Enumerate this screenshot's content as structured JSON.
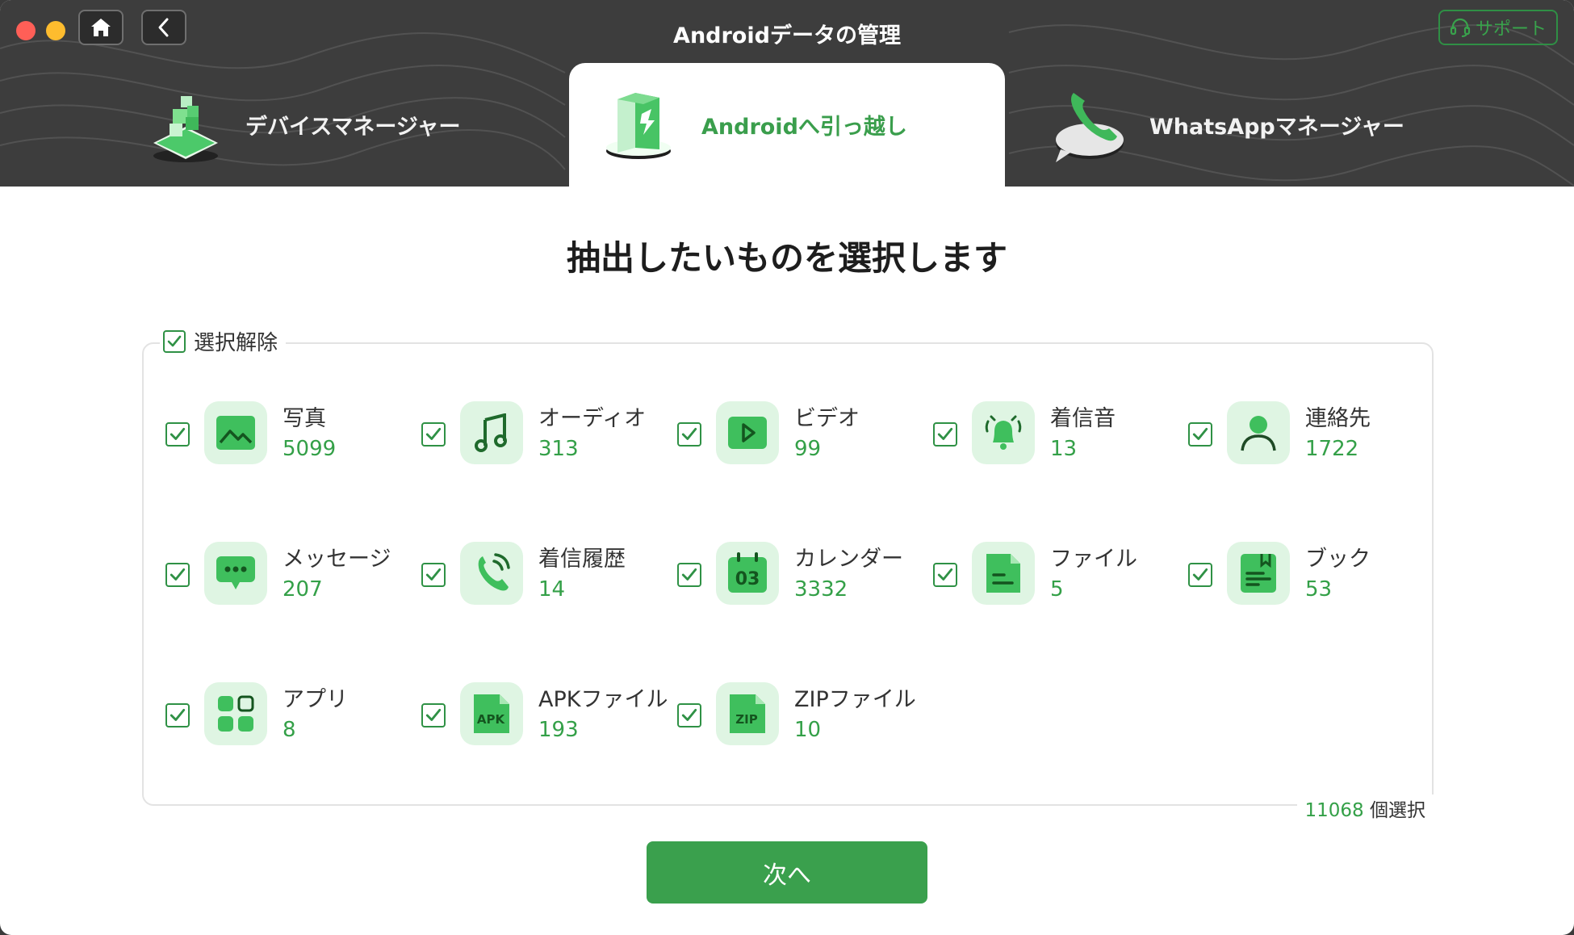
{
  "window": {
    "title": "Androidデータの管理",
    "support_label": "サポート"
  },
  "tabs": [
    {
      "label": "デバイスマネージャー",
      "icon": "device-manager-icon",
      "active": false
    },
    {
      "label": "Androidへ引っ越し",
      "icon": "android-transfer-icon",
      "active": true
    },
    {
      "label": "WhatsAppマネージャー",
      "icon": "whatsapp-phone-icon",
      "active": false
    }
  ],
  "main": {
    "heading": "抽出したいものを選択します",
    "deselect_label": "選択解除",
    "items": [
      {
        "name": "写真",
        "count": "5099",
        "icon": "photo-icon",
        "checked": true
      },
      {
        "name": "オーディオ",
        "count": "313",
        "icon": "music-note-icon",
        "checked": true
      },
      {
        "name": "ビデオ",
        "count": "99",
        "icon": "video-play-icon",
        "checked": true
      },
      {
        "name": "着信音",
        "count": "13",
        "icon": "ringtone-bell-icon",
        "checked": true
      },
      {
        "name": "連絡先",
        "count": "1722",
        "icon": "contact-person-icon",
        "checked": true
      },
      {
        "name": "メッセージ",
        "count": "207",
        "icon": "message-bubble-icon",
        "checked": true
      },
      {
        "name": "着信履歴",
        "count": "14",
        "icon": "call-history-icon",
        "checked": true
      },
      {
        "name": "カレンダー",
        "count": "3332",
        "icon": "calendar-icon",
        "checked": true
      },
      {
        "name": "ファイル",
        "count": "5",
        "icon": "file-icon",
        "checked": true
      },
      {
        "name": "ブック",
        "count": "53",
        "icon": "book-icon",
        "checked": true
      },
      {
        "name": "アプリ",
        "count": "8",
        "icon": "apps-grid-icon",
        "checked": true
      },
      {
        "name": "APKファイル",
        "count": "193",
        "icon": "apk-file-icon",
        "checked": true
      },
      {
        "name": "ZIPファイル",
        "count": "10",
        "icon": "zip-file-icon",
        "checked": true
      }
    ],
    "calendar_icon_text": "03",
    "apk_icon_text": "APK",
    "zip_icon_text": "ZIP",
    "selected_count": "11068",
    "selected_suffix": "個選択",
    "next_label": "次へ"
  },
  "colors": {
    "accent": "#3aa04d",
    "header_bg": "#3d3d3d",
    "icon_bg": "#dff5e3"
  }
}
